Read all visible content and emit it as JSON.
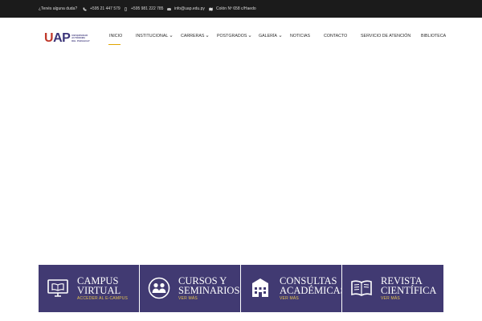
{
  "topbar": {
    "question": "¿Tenés alguna duda?",
    "phone1": "+595 21 447 579",
    "phone2": "+595 981 222 785",
    "email": "info@uap.edu.py",
    "address": "Colón Nº 658 c/Haedo"
  },
  "logo": {
    "mark": "UAP",
    "line1": "UNIVERSIDAD",
    "line2": "AUTÓNOMA",
    "line3": "DEL PARAGUAY"
  },
  "nav": {
    "items": [
      {
        "label": "INICIO"
      },
      {
        "label": "INSTITUCIONAL"
      },
      {
        "label": "CARRERAS"
      },
      {
        "label": "POSTGRADOS"
      },
      {
        "label": "GALERÍA"
      },
      {
        "label": "NOTICIAS"
      },
      {
        "label": "CONTACTO"
      },
      {
        "label": "SERVICIO DE ATENCIÓN"
      },
      {
        "label": "BIBLIOTECA"
      }
    ]
  },
  "cards": [
    {
      "title1": "CAMPUS",
      "title2": "VIRTUAL",
      "link": "ACCEDER AL E-CAMPUS"
    },
    {
      "title1": "CURSOS Y",
      "title2": "SEMINARIOS",
      "link": "VER MÁS"
    },
    {
      "title1": "CONSULTAS",
      "title2": "ACADÉMICAS",
      "link": "VER MÁS"
    },
    {
      "title1": "REVISTA",
      "title2": "CIENTÍFICA",
      "link": "VER MÁS"
    }
  ],
  "colors": {
    "topbar_bg": "#1b1b1b",
    "card_bg": "#413a72",
    "card_link": "#e6c350",
    "nav_active_underline": "#e0a500",
    "logo_red": "#c0392b",
    "logo_purple": "#3b3479"
  },
  "icons": {
    "phone": "phone-icon",
    "mobile": "mobile-icon",
    "email": "envelope-icon",
    "address": "map-icon",
    "campus": "monitor-book-icon",
    "cursos": "people-icon",
    "consultas": "building-icon",
    "revista": "open-book-icon"
  }
}
